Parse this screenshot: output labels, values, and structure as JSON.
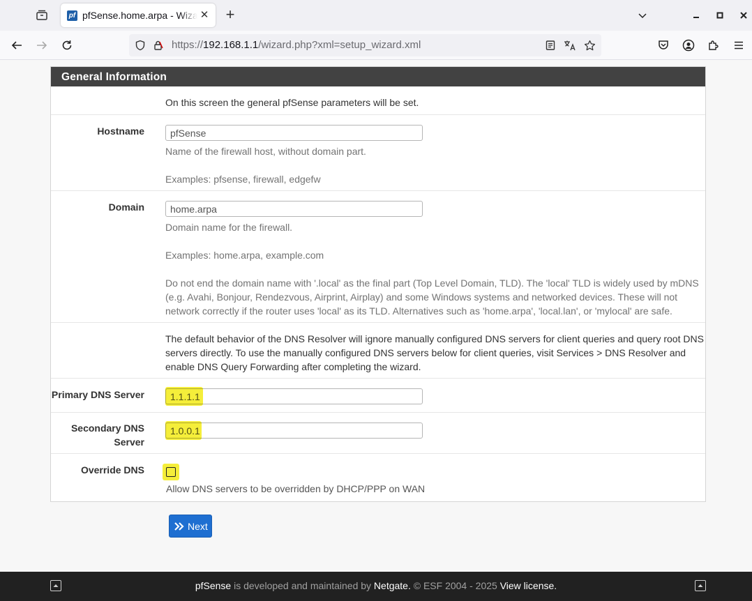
{
  "browser": {
    "tab_title": "pfSense.home.arpa - Wizard",
    "favicon_text": "pf",
    "url_scheme": "https://",
    "url_host": "192.168.1.1",
    "url_path": "/wizard.php?xml=setup_wizard.xml"
  },
  "panel": {
    "heading": "General Information",
    "intro": "On this screen the general pfSense parameters will be set.",
    "hostname": {
      "label": "Hostname",
      "value": "pfSense",
      "help1": "Name of the firewall host, without domain part.",
      "help2": "Examples: pfsense, firewall, edgefw"
    },
    "domain": {
      "label": "Domain",
      "value": "home.arpa",
      "help1": "Domain name for the firewall.",
      "help2": "Examples: home.arpa, example.com",
      "help3_line1": "Do not end the domain name with '.local' as the final part (Top Level Domain, TLD). The 'local' TLD is widely used by mDNS",
      "help3_line2": "(e.g. Avahi, Bonjour, Rendezvous, Airprint, Airplay) and some Windows systems and networked devices. These will not",
      "help3_line3": "network correctly if the router uses 'local' as its TLD. Alternatives such as 'home.arpa', 'local.lan', or 'mylocal' are safe."
    },
    "dns_note_line1": "The default behavior of the DNS Resolver will ignore manually configured DNS servers for client queries and query root DNS",
    "dns_note_line2": "servers directly. To use the manually configured DNS servers below for client queries, visit Services > DNS Resolver and",
    "dns_note_line3": "enable DNS Query Forwarding after completing the wizard.",
    "primary_dns": {
      "label": "Primary DNS Server",
      "value": "1.1.1.1"
    },
    "secondary_dns": {
      "label_line1": "Secondary DNS",
      "label_line2": "Server",
      "value": "1.0.0.1"
    },
    "override_dns": {
      "label": "Override DNS",
      "help": "Allow DNS servers to be overridden by DHCP/PPP on WAN",
      "checked": false
    }
  },
  "next_button": {
    "label": "Next"
  },
  "footer": {
    "brand": "pfSense",
    "text1": " is developed and maintained by ",
    "company": "Netgate.",
    "text2": " © ESF 2004 - 2025 ",
    "license": "View license."
  },
  "colors": {
    "highlight": "#f5ee3a",
    "heading_bg": "#424242",
    "button_blue": "#1e6fd1",
    "footer_bg": "#212121"
  }
}
